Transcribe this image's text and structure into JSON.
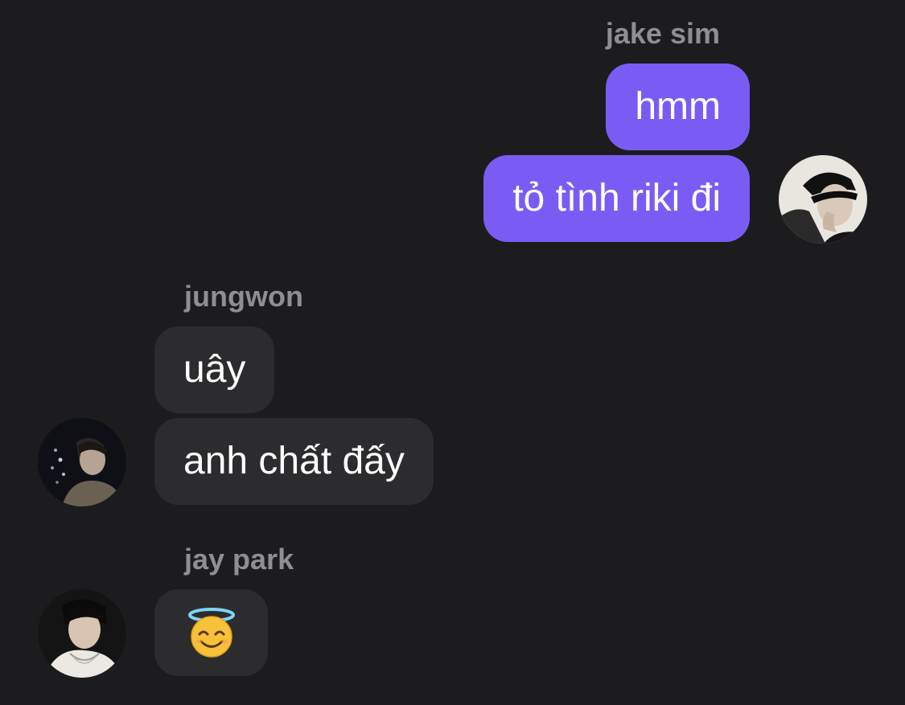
{
  "messages": [
    {
      "sender": "jake sim",
      "side": "right",
      "bubbles": [
        "hmm",
        "tỏ tình riki đi"
      ]
    },
    {
      "sender": "jungwon",
      "side": "left",
      "bubbles": [
        "uây",
        "anh chất đấy"
      ]
    },
    {
      "sender": "jay park",
      "side": "left",
      "bubbles": [
        {
          "icon": "smiling-face-with-halo-icon"
        }
      ]
    }
  ],
  "colors": {
    "background": "#1c1c1e",
    "outgoing_bubble": "#7a5cf5",
    "incoming_bubble": "#2c2c2e",
    "sender_name": "#8e8e93",
    "text": "#ffffff"
  }
}
